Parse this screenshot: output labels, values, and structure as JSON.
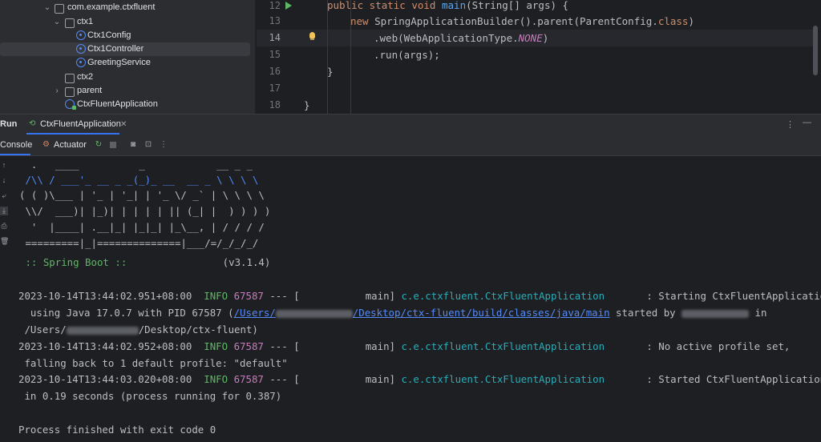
{
  "project_tree": {
    "items": [
      {
        "label": "com.example.ctxfluent",
        "kind": "package",
        "expanded": true
      },
      {
        "label": "ctx1",
        "kind": "folder",
        "expanded": true
      },
      {
        "label": "Ctx1Config",
        "kind": "class"
      },
      {
        "label": "Ctx1Controller",
        "kind": "class",
        "selected": true
      },
      {
        "label": "GreetingService",
        "kind": "class"
      },
      {
        "label": "ctx2",
        "kind": "folder"
      },
      {
        "label": "parent",
        "kind": "folder",
        "expanded": false
      },
      {
        "label": "CtxFluentApplication",
        "kind": "app-class"
      }
    ]
  },
  "editor": {
    "line_numbers": [
      "12",
      "13",
      "14",
      "15",
      "16",
      "17",
      "18"
    ],
    "current_line": "14",
    "code": {
      "l12_kw": "public static void ",
      "l12_fn": "main",
      "l12_rest": "(String[] args) {",
      "l13_kw": "new ",
      "l13_rest1": "SpringApplicationBuilder().parent(ParentConfig.",
      "l13_kw2": "class",
      "l13_rest2": ")",
      "l14_a": ".web(WebApplicationType.",
      "l14_const": "NONE",
      "l14_b": ")",
      "l15": ".run(args);",
      "l16": "}",
      "l18": "}"
    }
  },
  "run_window": {
    "title": "Run",
    "tab": "CtxFluentApplication",
    "console_tab": "Console",
    "actuator_tab": "Actuator"
  },
  "console": {
    "banner": [
      "  .   ____          _            __ _ _",
      " /\\\\ / ___'_ __ _ _(_)_ __  __ _ \\ \\ \\ \\",
      "( ( )\\___ | '_ | '_| | '_ \\/ _` | \\ \\ \\ \\",
      " \\\\/  ___)| |_)| | | | | || (_| |  ) ) ) )",
      "  '  |____| .__|_| |_|_| |_\\__, | / / / /",
      " =========|_|==============|___/=/_/_/_/"
    ],
    "spring_boot_label": " :: Spring Boot :: ",
    "spring_boot_version": "               (v3.1.4)",
    "log1_ts": "2023-10-14T13:44:02.951+08:00  ",
    "log2_ts": "2023-10-14T13:44:02.952+08:00  ",
    "log3_ts": "2023-10-14T13:44:03.020+08:00  ",
    "level": "INFO",
    "pid": "67587",
    "sep": " --- [           main] ",
    "logger": "c.e.ctxfluent.CtxFluentApplication",
    "log1_msg": "       : Starting CtxFluentApplication",
    "log1_cont_a": "  using Java 17.0.7 with PID 67587 (",
    "log1_link_a": "/Users/",
    "log1_link_b": "/Desktop/ctx-fluent/build/classes/java/main",
    "log1_cont_b": " started by ",
    "log1_cont_c": " in",
    "log1_path_a": " /Users/",
    "log1_path_b": "/Desktop/ctx-fluent)",
    "log2_msg": "       : No active profile set,",
    "log2_cont": " falling back to 1 default profile: \"default\"",
    "log3_msg": "       : Started CtxFluentApplication",
    "log3_cont": " in 0.19 seconds (process running for 0.387)",
    "exit": "Process finished with exit code 0"
  },
  "colors": {
    "accent": "#3574f0",
    "info_green": "#5fb865",
    "pid_purple": "#c77dbb",
    "logger_teal": "#2aacb8",
    "link_blue": "#548af7"
  }
}
